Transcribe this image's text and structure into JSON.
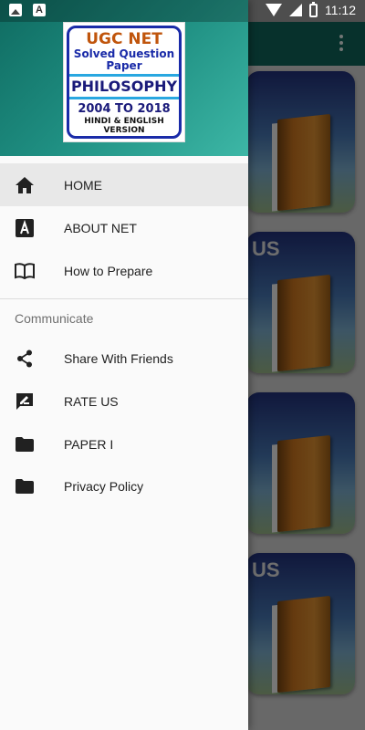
{
  "status_bar": {
    "time": "11:12",
    "left_icons": [
      "image-icon",
      "a-icon"
    ],
    "right_icons": [
      "wifi-icon",
      "signal-icon",
      "battery-icon"
    ]
  },
  "drawer": {
    "logo": {
      "line1": "UGC NET",
      "line2": "Solved Question",
      "line3": "Paper",
      "line4": "PHILOSOPHY",
      "line5": "2004 TO 2018",
      "line6": "HINDI & ENGLISH",
      "line7": "VERSION"
    },
    "menu": [
      {
        "label": "HOME",
        "icon": "home-icon",
        "active": true
      },
      {
        "label": "ABOUT NET",
        "icon": "a-box-icon",
        "active": false
      },
      {
        "label": "How to Prepare",
        "icon": "book-icon",
        "active": false
      }
    ],
    "section_title": "Communicate",
    "section_items": [
      {
        "label": "Share With Friends",
        "icon": "share-icon"
      },
      {
        "label": "RATE US",
        "icon": "rate-icon"
      },
      {
        "label": "PAPER I",
        "icon": "folder-icon"
      },
      {
        "label": "Privacy Policy",
        "icon": "folder-icon"
      }
    ]
  },
  "background": {
    "card_text": "US"
  },
  "colors": {
    "header": "#1f8f82",
    "toolbar": "#0e5a50",
    "active_item": "#e8e8e8"
  }
}
